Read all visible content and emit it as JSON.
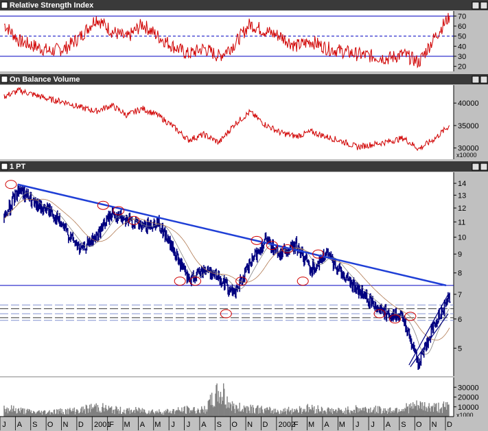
{
  "colors": {
    "titlebar": "#3a3a3a",
    "price_bar": "#000080",
    "indicator_line": "#d00000",
    "trendline": "#1f3fd6",
    "rsi_guides": "#0000c0",
    "moving_average_1": "#808080",
    "moving_average_2": "#b07850",
    "volume_bars": "#808080"
  },
  "panels": {
    "rsi": {
      "title": "Relative Strength Index",
      "ticks": [
        "70",
        "60",
        "50",
        "40",
        "30",
        "20"
      ]
    },
    "obv": {
      "title": "On Balance Volume",
      "ticks": [
        "40000",
        "35000",
        "30000"
      ],
      "unit": "x10000"
    },
    "price": {
      "title": "1 PT",
      "ticks": [
        "14",
        "13",
        "12",
        "11",
        "10",
        "9",
        "8",
        "7",
        "6",
        "5"
      ]
    },
    "volume": {
      "ticks": [
        "30000",
        "20000",
        "10000"
      ],
      "unit": "x1000"
    }
  },
  "x_axis": {
    "labels": [
      "J",
      "A",
      "S",
      "O",
      "N",
      "D",
      "2001",
      "F",
      "M",
      "A",
      "M",
      "J",
      "J",
      "A",
      "S",
      "O",
      "N",
      "D",
      "2002",
      "F",
      "M",
      "A",
      "M",
      "J",
      "J",
      "A",
      "S",
      "O",
      "N",
      "D"
    ]
  },
  "chart_data": [
    {
      "type": "line",
      "title": "Relative Strength Index",
      "ylim": [
        15,
        75
      ],
      "reference_lines": [
        70,
        50,
        30
      ],
      "x": [
        "Jul 2000",
        "Aug 2000",
        "Sep 2000",
        "Oct 2000",
        "Nov 2000",
        "Dec 2000",
        "Jan 2001",
        "Feb 2001",
        "Mar 2001",
        "Apr 2001",
        "May 2001",
        "Jun 2001",
        "Jul 2001",
        "Aug 2001",
        "Sep 2001",
        "Oct 2001",
        "Nov 2001",
        "Dec 2001",
        "Jan 2002",
        "Feb 2002",
        "Mar 2002",
        "Apr 2002",
        "May 2002",
        "Jun 2002",
        "Jul 2002",
        "Aug 2002",
        "Sep 2002",
        "Oct 2002",
        "Nov 2002",
        "Dec 2002"
      ],
      "series": [
        {
          "values": [
            62,
            45,
            40,
            35,
            38,
            50,
            68,
            55,
            48,
            62,
            50,
            40,
            32,
            38,
            30,
            42,
            62,
            55,
            50,
            40,
            45,
            38,
            35,
            32,
            30,
            28,
            32,
            24,
            48,
            70
          ]
        }
      ]
    },
    {
      "type": "line",
      "title": "On Balance Volume",
      "ylabel": "x10000",
      "ylim": [
        27500,
        44000
      ],
      "x": [
        "Jul 2000",
        "Aug 2000",
        "Sep 2000",
        "Oct 2000",
        "Nov 2000",
        "Dec 2000",
        "Jan 2001",
        "Feb 2001",
        "Mar 2001",
        "Apr 2001",
        "May 2001",
        "Jun 2001",
        "Jul 2001",
        "Aug 2001",
        "Sep 2001",
        "Oct 2001",
        "Nov 2001",
        "Dec 2001",
        "Jan 2002",
        "Feb 2002",
        "Mar 2002",
        "Apr 2002",
        "May 2002",
        "Jun 2002",
        "Jul 2002",
        "Aug 2002",
        "Sep 2002",
        "Oct 2002",
        "Nov 2002",
        "Dec 2002"
      ],
      "series": [
        {
          "values": [
            41500,
            42800,
            41800,
            40800,
            40200,
            39000,
            38200,
            39500,
            37300,
            38800,
            37300,
            34800,
            31800,
            33000,
            31200,
            35300,
            38000,
            35200,
            33400,
            32600,
            33600,
            32500,
            31500,
            30200,
            30800,
            31400,
            32200,
            29800,
            32000,
            35000
          ]
        }
      ]
    },
    {
      "type": "bar",
      "title": "1 PT",
      "ylim": [
        4.2,
        15
      ],
      "log_scale": true,
      "x": [
        "Jul 2000",
        "Aug 2000",
        "Sep 2000",
        "Oct 2000",
        "Nov 2000",
        "Dec 2000",
        "Jan 2001",
        "Feb 2001",
        "Mar 2001",
        "Apr 2001",
        "May 2001",
        "Jun 2001",
        "Jul 2001",
        "Aug 2001",
        "Sep 2001",
        "Oct 2001",
        "Nov 2001",
        "Dec 2001",
        "Jan 2002",
        "Feb 2002",
        "Mar 2002",
        "Apr 2002",
        "May 2002",
        "Jun 2002",
        "Jul 2002",
        "Aug 2002",
        "Sep 2002",
        "Oct 2002",
        "Nov 2002",
        "Dec 2002"
      ],
      "series": [
        {
          "values": [
            11.2,
            13.6,
            12.2,
            11.8,
            10.4,
            9.2,
            10.0,
            11.6,
            11.2,
            10.6,
            11.0,
            9.2,
            7.6,
            8.2,
            7.8,
            7.0,
            8.4,
            9.8,
            9.0,
            9.5,
            8.2,
            9.0,
            8.0,
            7.2,
            6.6,
            6.2,
            6.0,
            4.5,
            5.8,
            6.9
          ]
        }
      ],
      "annotations": {
        "resistance_trendline": [
          {
            "x": "Jul 2000",
            "y": 13.9
          },
          {
            "x": "Dec 2002",
            "y": 7.4
          }
        ],
        "horizontal_support": [
          7.4
        ],
        "dashed_levels": [
          6.55,
          6.4,
          6.2,
          6.05,
          5.95
        ],
        "circled_points": [
          {
            "x": "Jul 2000",
            "y": 13.9
          },
          {
            "x": "Jan 2001",
            "y": 12.2
          },
          {
            "x": "Feb 2001",
            "y": 11.8
          },
          {
            "x": "Mar 2001",
            "y": 11.1
          },
          {
            "x": "Jun 2001",
            "y": 7.6
          },
          {
            "x": "Jul 2001",
            "y": 7.6
          },
          {
            "x": "Sep 2001",
            "y": 6.2
          },
          {
            "x": "Oct 2001",
            "y": 7.6
          },
          {
            "x": "Nov 2001",
            "y": 9.8
          },
          {
            "x": "Dec 2001",
            "y": 9.5
          },
          {
            "x": "Jan 2002",
            "y": 9.3
          },
          {
            "x": "Feb 2002",
            "y": 7.6
          },
          {
            "x": "Mar 2002",
            "y": 9.0
          },
          {
            "x": "Jul 2002",
            "y": 6.2
          },
          {
            "x": "Aug 2002",
            "y": 6.0
          },
          {
            "x": "Sep 2002",
            "y": 6.1
          }
        ]
      }
    },
    {
      "type": "bar",
      "title": "",
      "ylabel": "x1000",
      "ylim": [
        0,
        40000
      ],
      "x": [
        "Jul 2000",
        "Aug 2000",
        "Sep 2000",
        "Oct 2000",
        "Nov 2000",
        "Dec 2000",
        "Jan 2001",
        "Feb 2001",
        "Mar 2001",
        "Apr 2001",
        "May 2001",
        "Jun 2001",
        "Jul 2001",
        "Aug 2001",
        "Sep 2001",
        "Oct 2001",
        "Nov 2001",
        "Dec 2001",
        "Jan 2002",
        "Feb 2002",
        "Mar 2002",
        "Apr 2002",
        "May 2002",
        "Jun 2002",
        "Jul 2002",
        "Aug 2002",
        "Sep 2002",
        "Oct 2002",
        "Nov 2002",
        "Dec 2002"
      ],
      "series": [
        {
          "values": [
            12000,
            9000,
            6000,
            7000,
            8000,
            9000,
            14000,
            10000,
            8000,
            9000,
            7000,
            8000,
            10000,
            9000,
            34000,
            12000,
            13000,
            9000,
            8000,
            10000,
            12000,
            9000,
            8000,
            11000,
            10000,
            9000,
            12000,
            15000,
            13000,
            14000
          ]
        }
      ]
    }
  ]
}
